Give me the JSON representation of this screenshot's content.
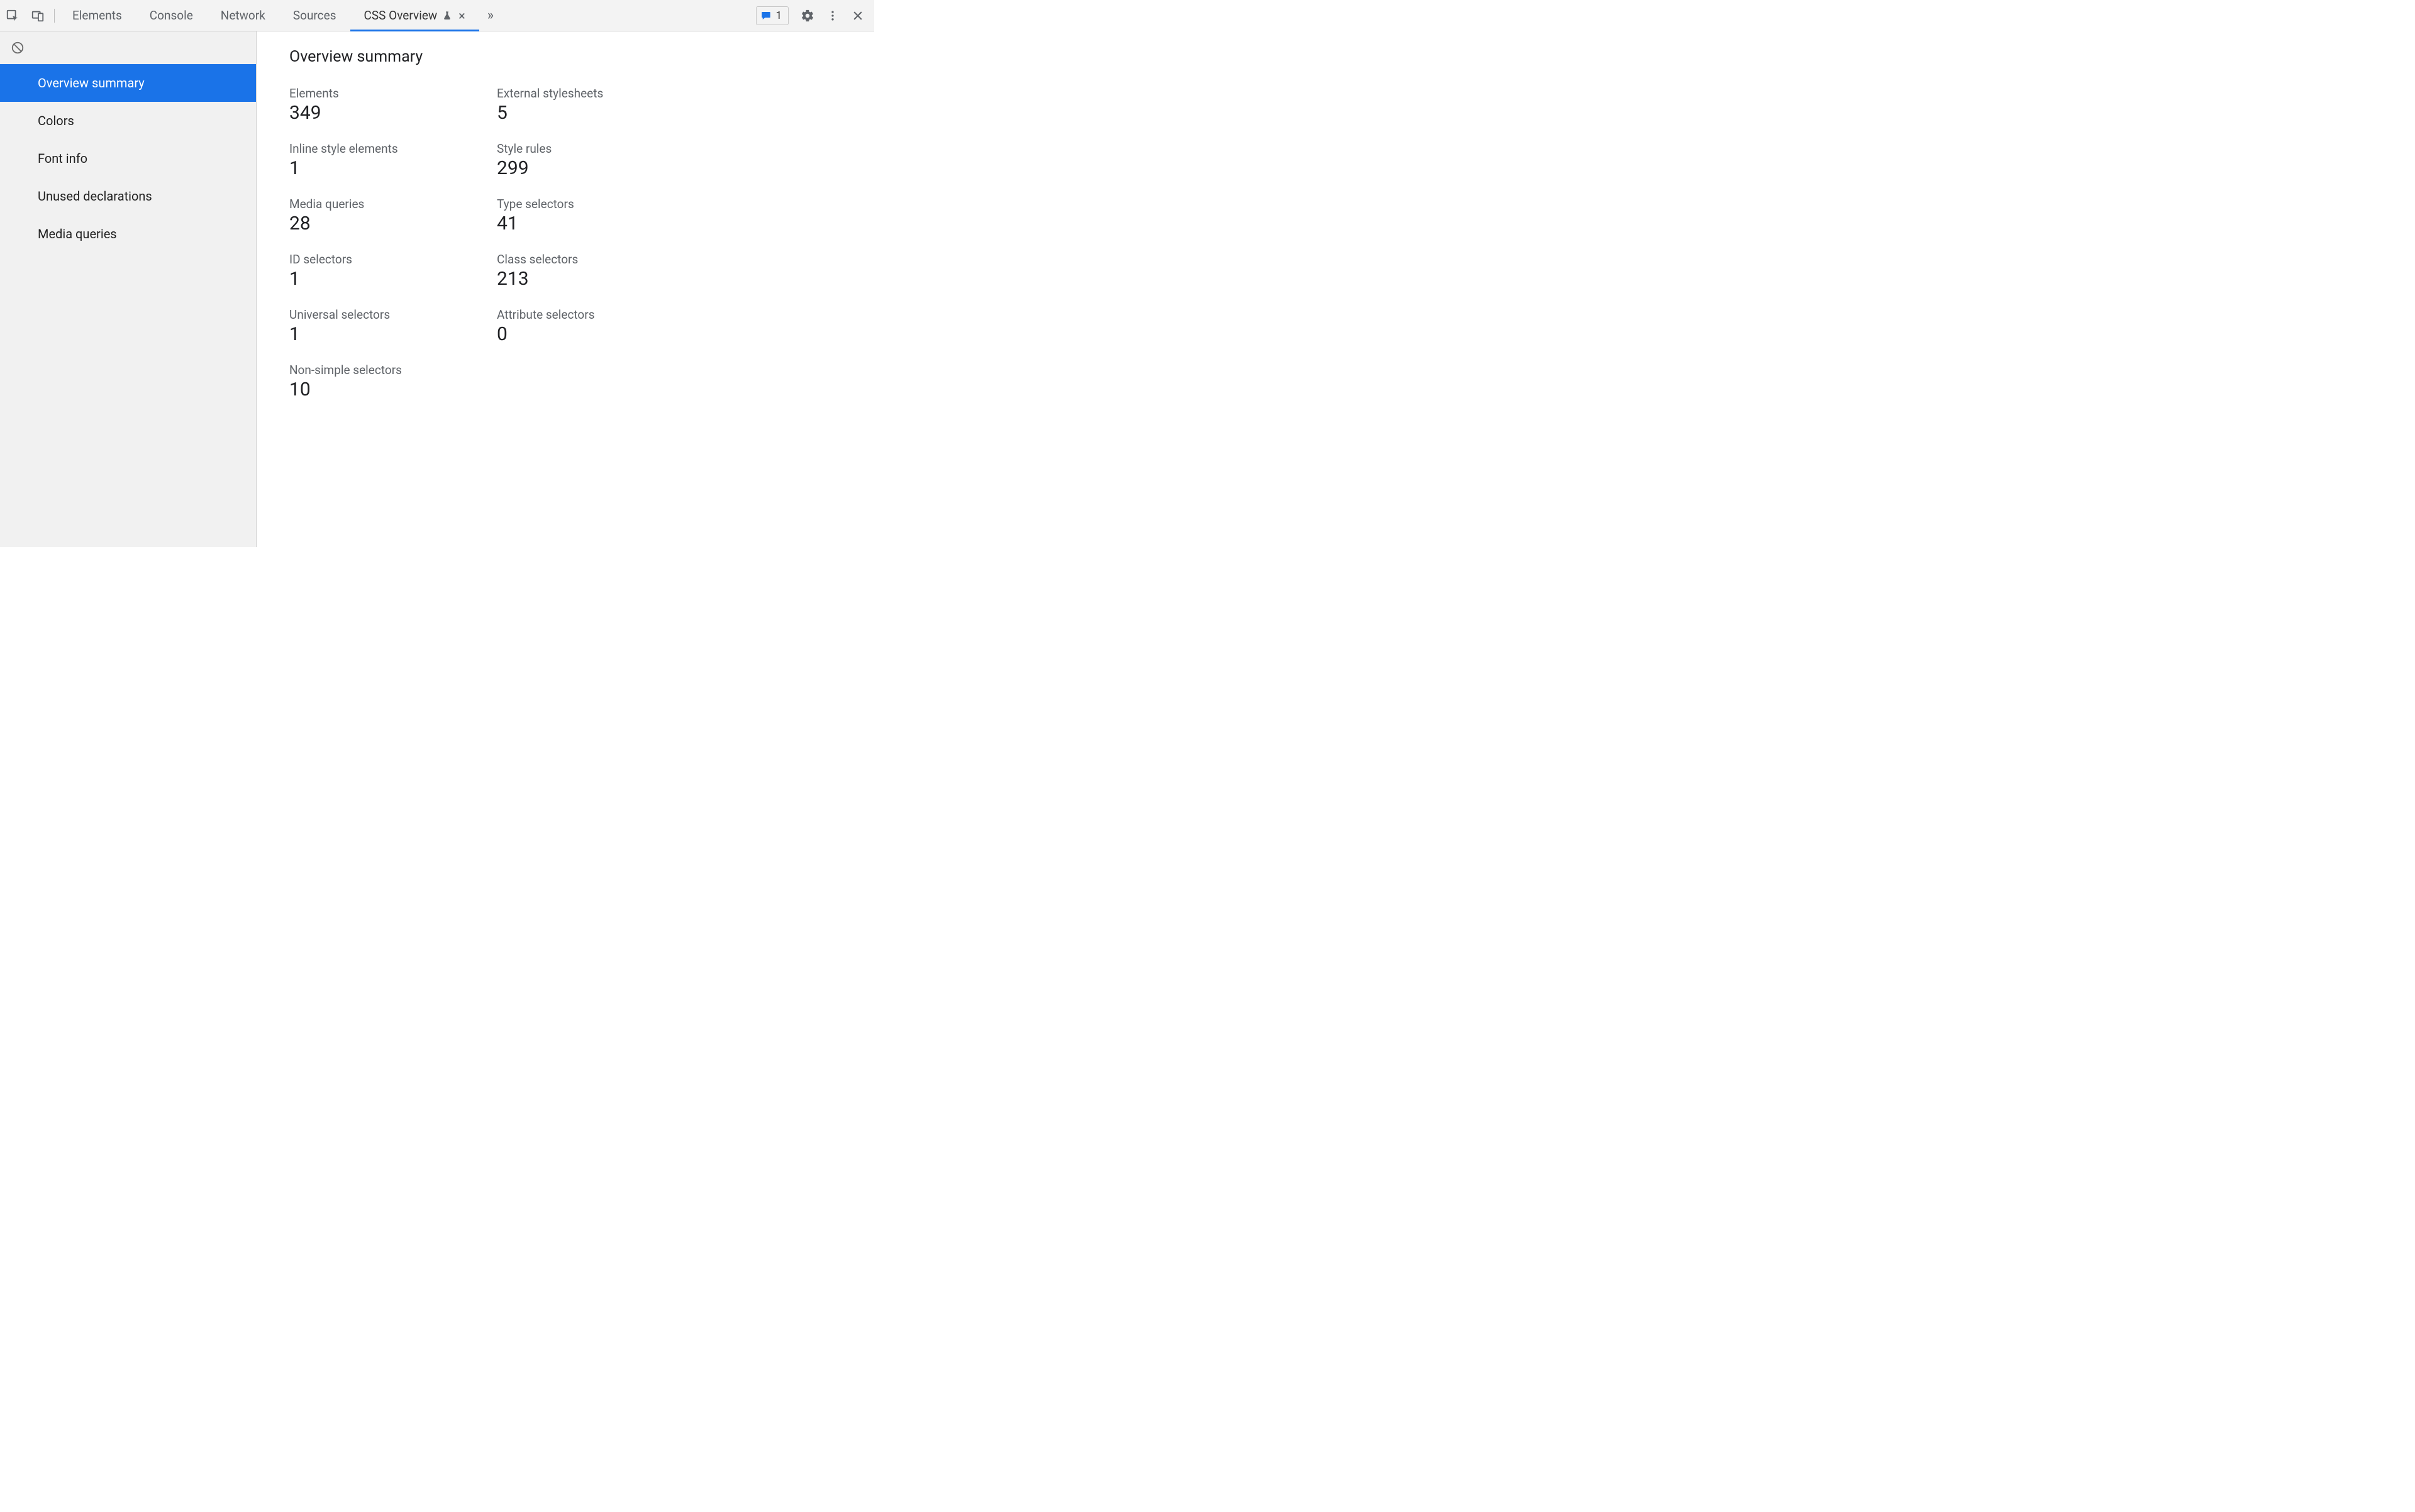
{
  "tabs": {
    "items": [
      {
        "label": "Elements"
      },
      {
        "label": "Console"
      },
      {
        "label": "Network"
      },
      {
        "label": "Sources"
      },
      {
        "label": "CSS Overview"
      }
    ],
    "active_index": 4,
    "active_experimental": true
  },
  "toolbar_right": {
    "issues_count": "1"
  },
  "sidebar": {
    "items": [
      {
        "label": "Overview summary"
      },
      {
        "label": "Colors"
      },
      {
        "label": "Font info"
      },
      {
        "label": "Unused declarations"
      },
      {
        "label": "Media queries"
      }
    ],
    "selected_index": 0
  },
  "main": {
    "title": "Overview summary",
    "stats": [
      {
        "label": "Elements",
        "value": "349"
      },
      {
        "label": "External stylesheets",
        "value": "5"
      },
      {
        "label": "Inline style elements",
        "value": "1"
      },
      {
        "label": "Style rules",
        "value": "299"
      },
      {
        "label": "Media queries",
        "value": "28"
      },
      {
        "label": "Type selectors",
        "value": "41"
      },
      {
        "label": "ID selectors",
        "value": "1"
      },
      {
        "label": "Class selectors",
        "value": "213"
      },
      {
        "label": "Universal selectors",
        "value": "1"
      },
      {
        "label": "Attribute selectors",
        "value": "0"
      },
      {
        "label": "Non-simple selectors",
        "value": "10"
      }
    ]
  }
}
